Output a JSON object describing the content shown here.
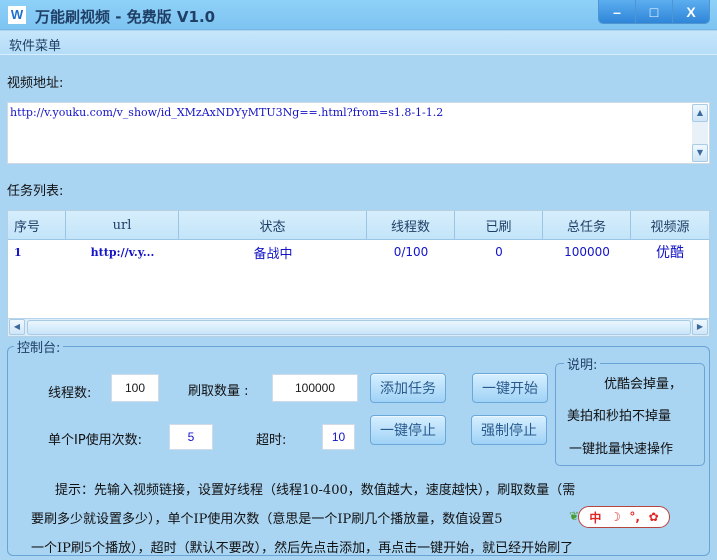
{
  "window": {
    "icon_letter": "W",
    "title": "万能刷视频 - 免费版 V1.0",
    "controls": {
      "minimize": "–",
      "maximize": "□",
      "close": "X"
    }
  },
  "menu": {
    "items": [
      "软件菜单"
    ]
  },
  "video_address": {
    "label": "视频地址:",
    "value": "http://v.youku.com/v_show/id_XMzAxNDYyMTU3Ng==.html?from=s1.8-1-1.2"
  },
  "task_list": {
    "label": "任务列表:",
    "columns": [
      "序号",
      "url",
      "状态",
      "线程数",
      "已刷",
      "总任务",
      "视频源"
    ],
    "rows": [
      {
        "index": "1",
        "url": "http://v.y...",
        "status": "备战中",
        "threads": "0/100",
        "done": "0",
        "total": "100000",
        "source": "优酷"
      }
    ]
  },
  "console": {
    "legend": "控制台:",
    "threads_label": "线程数:",
    "threads_value": "100",
    "count_label": "刷取数量 :",
    "count_value": "100000",
    "ip_uses_label": "单个IP使用次数:",
    "ip_uses_value": "5",
    "timeout_label": "超时:",
    "timeout_value": "10",
    "buttons": {
      "add_task": "添加任务",
      "start_all": "一键开始",
      "stop_all": "一键停止",
      "force_stop": "强制停止"
    },
    "notes": {
      "legend": "说明:",
      "lines": [
        "优酷会掉量，",
        "美拍和秒拍不掉量",
        "一键批量快速操作"
      ]
    },
    "tips": [
      "提示：先输入视频链接，设置好线程（线程10-400，数值越大，速度越快），刷取数量（需",
      "要刷多少就设置多少），单个IP使用次数（意思是一个IP刷几个播放量，数值设置5",
      "一个IP刷5个播放），超时（默认不要改），然后先点击添加，再点击一键开始，就已经开始刷了"
    ]
  },
  "ime_toolbar": {
    "items": [
      "中",
      "☽",
      "°,",
      "✿"
    ]
  }
}
